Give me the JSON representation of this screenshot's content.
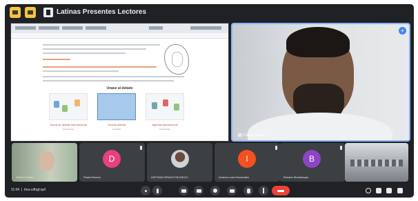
{
  "window": {
    "title": "Latinas Presentes Lectores"
  },
  "presentation": {
    "heading": "Unase al debate",
    "cards": [
      {
        "caption": "Roma de debate internacional",
        "sub": "Facultad de"
      },
      {
        "caption": "Ciencia abierta",
        "sub": "Facultad"
      },
      {
        "caption": "Agenda internacional",
        "sub": "Facultad de"
      }
    ]
  },
  "speaker": {
    "name": "Carlos Garcia"
  },
  "participants": [
    {
      "name": "Gisela Chavez",
      "initial": ""
    },
    {
      "name": "Paula Moreno",
      "initial": "D",
      "color": "#e8417d"
    },
    {
      "name": "ANTONIO BRAVO PACHECO",
      "initial": ""
    },
    {
      "name": "Andrea Lucia Hernandez",
      "initial": "I",
      "color": "#f4511e"
    },
    {
      "name": "Rosario Montenegro",
      "initial": "B",
      "color": "#8e44c4"
    },
    {
      "name": "",
      "initial": ""
    }
  ],
  "footer": {
    "time": "11:04",
    "meeting_code": "bnu-cdhgt-quf"
  },
  "colors": {
    "leave": "#ea4335",
    "pin": "#4285f4",
    "active_border": "#8ab4f8"
  }
}
